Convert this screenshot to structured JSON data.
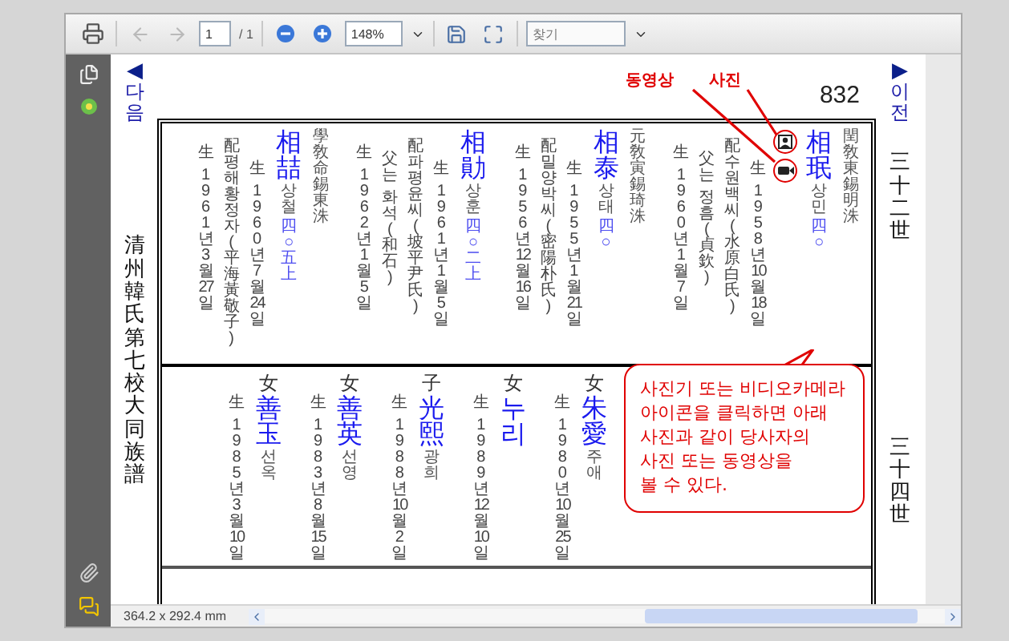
{
  "toolbar": {
    "page_field": "1",
    "page_total": "/ 1",
    "zoom_field": "148%",
    "search": {
      "placeholder": "찾기"
    },
    "page_nav_disabled": true
  },
  "page": {
    "prev_link": {
      "arrow": "◀",
      "label": "다음"
    },
    "next_link": {
      "arrow": "▶",
      "label": "이전"
    },
    "title": "清州韓氏第七校大同族譜",
    "page_number": "832",
    "generations": [
      "三十二世",
      "三十四世"
    ]
  },
  "top_row": [
    {
      "columns": [
        {
          "kind": "spouse_birth",
          "text": "生 1961년3월27일"
        },
        {
          "kind": "spouse",
          "text": "配평해황정자(平海黃敬子)"
        },
        {
          "kind": "birth",
          "text": "生 1960년7월24일"
        },
        {
          "kind": "name",
          "name": "相喆",
          "reading": "상철",
          "mark": "四○五上"
        },
        {
          "kind": "lineage",
          "text": "學敎命錫東洙"
        }
      ]
    },
    {
      "columns": [
        {
          "kind": "spouse_birth",
          "text": "生 1962년1월5일"
        },
        {
          "kind": "father",
          "text": "父는 화석(和石)"
        },
        {
          "kind": "spouse",
          "text": "配파평윤씨(坡平尹氏)"
        },
        {
          "kind": "birth",
          "text": "生 1961년1월5일"
        },
        {
          "kind": "name",
          "name": "相勛",
          "reading": "상훈",
          "mark": "四○二上"
        }
      ]
    },
    {
      "columns": [
        {
          "kind": "spouse_birth",
          "text": "生 1956년12월16일"
        },
        {
          "kind": "spouse",
          "text": "配밀양박씨(密陽朴氏)"
        },
        {
          "kind": "birth",
          "text": "生 1955년1월21일"
        },
        {
          "kind": "name",
          "name": "相泰",
          "reading": "상태",
          "mark": "四○"
        },
        {
          "kind": "lineage",
          "text": "元敎寅錫琦洙"
        }
      ]
    },
    {
      "columns": [
        {
          "kind": "spouse_birth",
          "text": "生 1960년1월7일"
        },
        {
          "kind": "father",
          "text": "父는 정흠(貞欽)"
        },
        {
          "kind": "spouse",
          "text": "配수원백씨(水原白氏)"
        },
        {
          "kind": "birth",
          "text": "生 1958년10월18일"
        },
        {
          "kind": "media",
          "photo": true,
          "video": true
        },
        {
          "kind": "name",
          "name": "相珉",
          "reading": "상민",
          "mark": "四○"
        },
        {
          "kind": "lineage",
          "text": "閏敎東錫明洙"
        }
      ]
    }
  ],
  "bottom_row": [
    {
      "relation": "女",
      "name": "善玉",
      "reading": "선옥",
      "birth": "生 1985년3월10일"
    },
    {
      "relation": "女",
      "name": "善英",
      "reading": "선영",
      "birth": "生 1983년8월15일"
    },
    {
      "relation": "子",
      "name": "光熙",
      "reading": "광희",
      "birth": "生 1988년10월2일"
    },
    {
      "relation": "女",
      "name": "누리",
      "birth": "生 1989년12월10일"
    },
    {
      "relation": "女",
      "name": "朱愛",
      "reading": "주애",
      "birth": "生 1980년10월25일"
    }
  ],
  "annotation": {
    "video_label": "동영상",
    "photo_label": "사진",
    "callout": "사진기 또는 비디오카메라\n아이콘을 클릭하면 아래\n사진과 같이 당사자의\n사진 또는 동영상을\n볼 수 있다."
  },
  "status_bar": {
    "page_size": "364.2 x 292.4 mm"
  }
}
